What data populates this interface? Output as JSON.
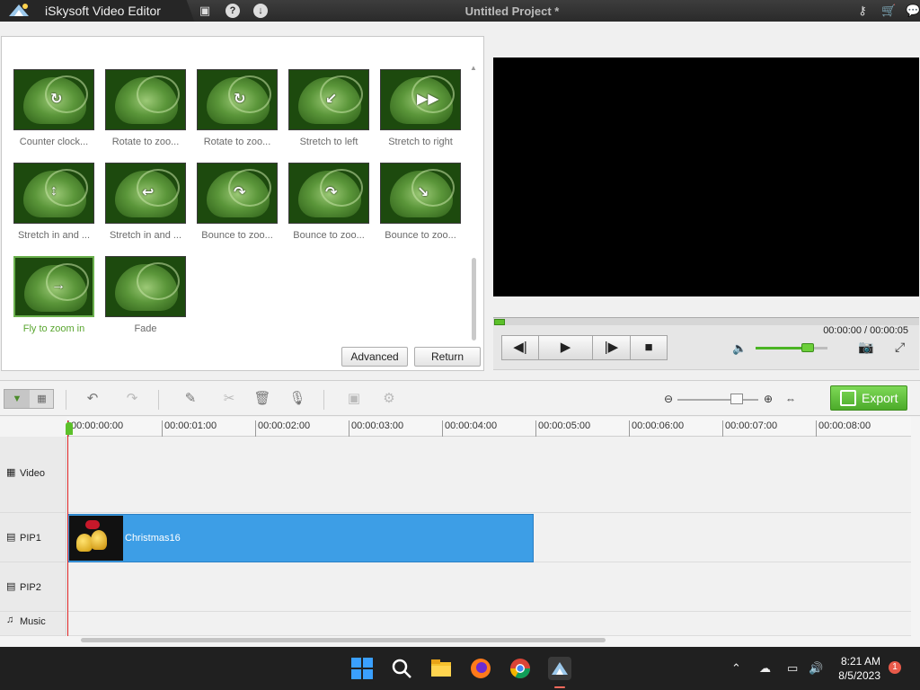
{
  "app": {
    "title": "iSkysoft Video Editor",
    "project_title": "Untitled Project *"
  },
  "effects": [
    {
      "label": "Counter clock...",
      "arrow": "↻",
      "selected": false
    },
    {
      "label": "Rotate to zoo...",
      "arrow": "",
      "selected": false
    },
    {
      "label": "Rotate to zoo...",
      "arrow": "↻",
      "selected": false
    },
    {
      "label": "Stretch to left",
      "arrow": "↙",
      "selected": false
    },
    {
      "label": "Stretch to right",
      "arrow": "▶▶",
      "selected": false
    },
    {
      "label": "Stretch in and ...",
      "arrow": "↕",
      "selected": false
    },
    {
      "label": "Stretch in and ...",
      "arrow": "↩",
      "selected": false
    },
    {
      "label": "Bounce to zoo...",
      "arrow": "↷",
      "selected": false
    },
    {
      "label": "Bounce to zoo...",
      "arrow": "↷",
      "selected": false
    },
    {
      "label": "Bounce to zoo...",
      "arrow": "↘",
      "selected": false
    },
    {
      "label": "Fly to zoom in",
      "arrow": "→",
      "selected": true
    },
    {
      "label": "Fade",
      "arrow": "",
      "selected": false
    }
  ],
  "buttons": {
    "advanced": "Advanced",
    "return": "Return",
    "export": "Export"
  },
  "player": {
    "timecode": "00:00:00 / 00:00:05",
    "volume_level": 0.72
  },
  "timeline": {
    "ticks": [
      "00:00:00:00",
      "00:00:01:00",
      "00:00:02:00",
      "00:00:03:00",
      "00:00:04:00",
      "00:00:05:00",
      "00:00:06:00",
      "00:00:07:00",
      "00:00:08:00"
    ],
    "tracks": [
      "Video",
      "PIP1",
      "PIP2",
      "Music"
    ],
    "clip": {
      "name": "Christmas16"
    }
  },
  "taskbar": {
    "time": "8:21 AM",
    "date": "8/5/2023",
    "notification_count": "1"
  },
  "colors": {
    "accent_green": "#5aa630",
    "clip_blue": "#3d9ee6",
    "titlebar": "#2e2e2e"
  }
}
